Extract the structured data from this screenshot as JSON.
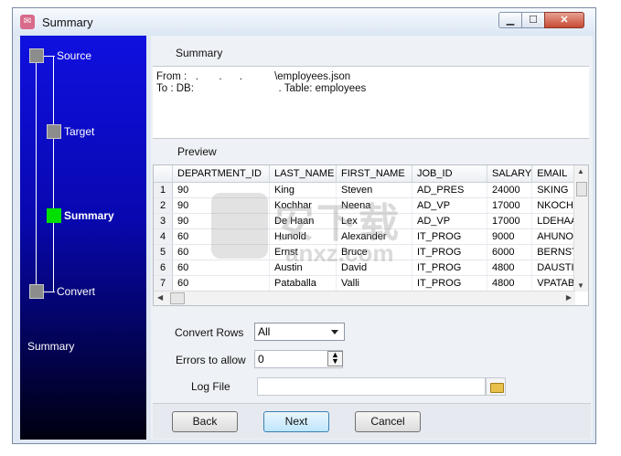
{
  "window": {
    "title": "Summary"
  },
  "sidebar": {
    "steps": [
      {
        "label": "Source",
        "active": false
      },
      {
        "label": "Target",
        "active": false
      },
      {
        "label": "Summary",
        "active": true
      },
      {
        "label": "Convert",
        "active": false
      }
    ],
    "footer_label": "Summary"
  },
  "summary": {
    "title": "Summary",
    "from_line": "From :   .       .      .           \\employees.json",
    "to_line": "To : DB:                             . Table: employees"
  },
  "preview": {
    "title": "Preview",
    "columns": [
      "DEPARTMENT_ID",
      "LAST_NAME",
      "FIRST_NAME",
      "JOB_ID",
      "SALARY",
      "EMAIL"
    ],
    "rows": [
      {
        "num": "1",
        "cells": [
          "90",
          "King",
          "Steven",
          "AD_PRES",
          "24000",
          "SKING"
        ]
      },
      {
        "num": "2",
        "cells": [
          "90",
          "Kochhar",
          "Neena",
          "AD_VP",
          "17000",
          "NKOCHH"
        ]
      },
      {
        "num": "3",
        "cells": [
          "90",
          "De Haan",
          "Lex",
          "AD_VP",
          "17000",
          "LDEHAAN"
        ]
      },
      {
        "num": "4",
        "cells": [
          "60",
          "Hunold",
          "Alexander",
          "IT_PROG",
          "9000",
          "AHUNOL"
        ]
      },
      {
        "num": "5",
        "cells": [
          "60",
          "Ernst",
          "Bruce",
          "IT_PROG",
          "6000",
          "BERNST"
        ]
      },
      {
        "num": "6",
        "cells": [
          "60",
          "Austin",
          "David",
          "IT_PROG",
          "4800",
          "DAUSTIN"
        ]
      },
      {
        "num": "7",
        "cells": [
          "60",
          "Pataballa",
          "Valli",
          "IT_PROG",
          "4800",
          "VPATABA"
        ]
      }
    ]
  },
  "form": {
    "convert_rows_label": "Convert Rows",
    "convert_rows_value": "All",
    "errors_label": "Errors to allow",
    "errors_value": "0",
    "logfile_label": "Log File",
    "logfile_value": ""
  },
  "buttons": {
    "back": "Back",
    "next": "Next",
    "cancel": "Cancel"
  },
  "watermark": {
    "text": "安下载",
    "sub": "anxz.com"
  },
  "colors": {
    "active_step": "#00e000",
    "sidebar_top": "#1010e0",
    "sidebar_bottom": "#000010"
  }
}
